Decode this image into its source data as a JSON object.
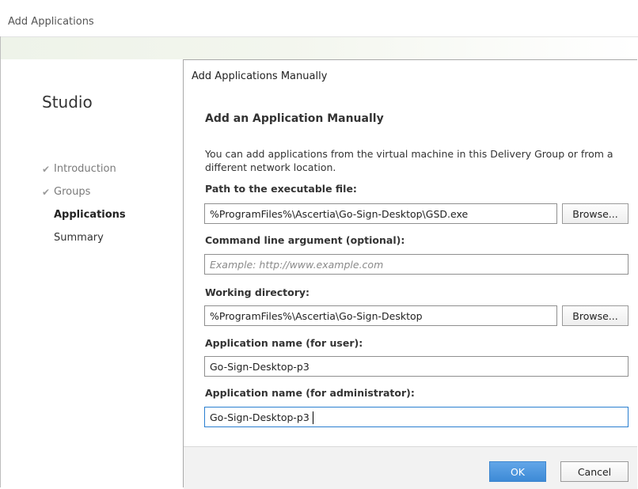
{
  "window": {
    "title": "Add Applications"
  },
  "wizard": {
    "brand": "Studio",
    "steps": [
      {
        "label": "Introduction",
        "state": "done"
      },
      {
        "label": "Groups",
        "state": "done"
      },
      {
        "label": "Applications",
        "state": "current"
      },
      {
        "label": "Summary",
        "state": "pending"
      }
    ],
    "check_glyph": "✔"
  },
  "dialog": {
    "title": "Add Applications Manually",
    "heading": "Add an Application Manually",
    "description": "You can add applications from the virtual machine in this Delivery Group or from a different network location.",
    "fields": {
      "path": {
        "label": "Path to the executable file:",
        "value": "%ProgramFiles%\\Ascertia\\Go-Sign-Desktop\\GSD.exe",
        "browse_label": "Browse..."
      },
      "args": {
        "label": "Command line argument (optional):",
        "value": "",
        "placeholder": "Example: http://www.example.com"
      },
      "workdir": {
        "label": "Working directory:",
        "value": "%ProgramFiles%\\Ascertia\\Go-Sign-Desktop",
        "browse_label": "Browse..."
      },
      "user_name": {
        "label": "Application name (for user):",
        "value": "Go-Sign-Desktop-p3"
      },
      "admin_name": {
        "label": "Application name (for administrator):",
        "value": "Go-Sign-Desktop-p3"
      }
    },
    "buttons": {
      "ok": "OK",
      "cancel": "Cancel"
    }
  },
  "colors": {
    "accent": "#3d8ad6",
    "focus_border": "#2a7fd0",
    "band_tint": "#eef3e9"
  }
}
